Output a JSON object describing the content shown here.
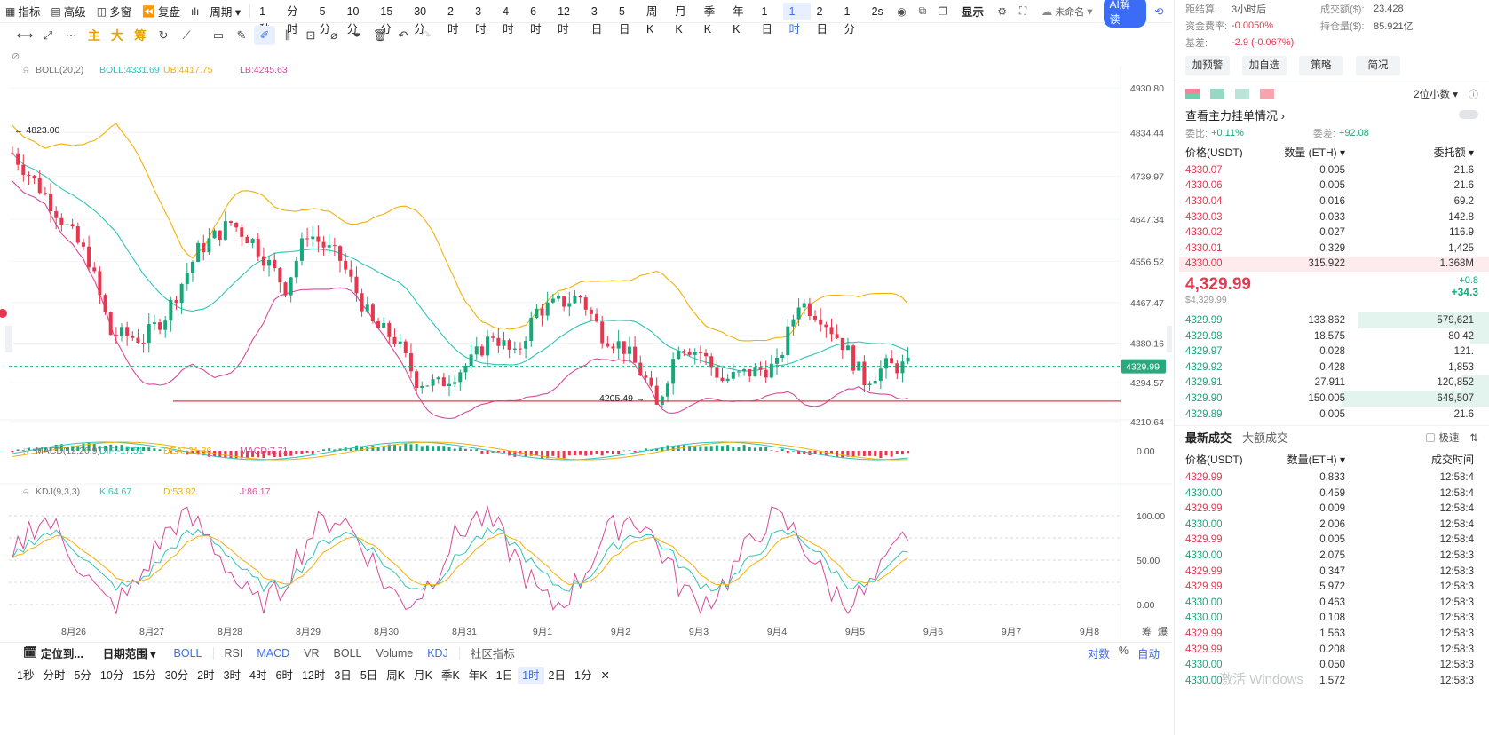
{
  "toolbar": {
    "items": [
      {
        "icon": "indicator-icon",
        "glyph": "▦",
        "label": "指标"
      },
      {
        "icon": "advanced-icon",
        "glyph": "▤",
        "label": "高级"
      },
      {
        "icon": "multi-window-icon",
        "glyph": "◫",
        "label": "多窗"
      },
      {
        "icon": "replay-icon",
        "glyph": "⏪",
        "label": "复盘"
      },
      {
        "icon": "candle-style-icon",
        "glyph": "ılı",
        "label": ""
      },
      {
        "icon": "period-icon",
        "glyph": "",
        "label": "周期 ▾"
      }
    ],
    "intervals": [
      "1秒",
      "分时",
      "5分",
      "10分",
      "15分",
      "30分",
      "2时",
      "3时",
      "4时",
      "6时",
      "12时",
      "3日",
      "5日",
      "周K",
      "月K",
      "季K",
      "年K",
      "1日",
      "1时",
      "2日",
      "1分"
    ],
    "active_interval": "1时",
    "right": {
      "speed": "2s",
      "display": "显示",
      "layout_name": "未命名",
      "ai_label": "AI解读"
    }
  },
  "drawtools": {
    "main_label": "主",
    "big_label": "大",
    "chip_label": "筹"
  },
  "chart": {
    "boll_legend": {
      "name": "BOLL(20,2)",
      "boll": "BOLL:4331.69",
      "ub": "UB:4417.75",
      "lb": "LB:4245.63"
    },
    "macd_legend": {
      "name": "MACD(12,26,9)",
      "dif": "DIF:-17.51",
      "dea": "DEA:-21.36",
      "macd": "MACD:7.71"
    },
    "kdj_legend": {
      "name": "KDJ(9,3,3)",
      "k": "K:64.67",
      "d": "D:53.92",
      "j": "J:86.17"
    },
    "price_axis": [
      "4930.80",
      "4834.44",
      "4739.97",
      "4647.34",
      "4556.52",
      "4467.47",
      "4380.16",
      "4294.57",
      "4210.64"
    ],
    "current_price": "4329.99",
    "high_label": "4823.00",
    "low_label": "4205.49",
    "support_level": 4255,
    "macd_axis": [
      "0.00"
    ],
    "kdj_axis": [
      "100.00",
      "50.00",
      "0.00"
    ],
    "dates": [
      "8月26",
      "8月27",
      "8月28",
      "8月29",
      "8月30",
      "8月31",
      "9月1",
      "9月2",
      "9月3",
      "9月4",
      "9月5",
      "9月6",
      "9月7",
      "9月8"
    ],
    "corner_labels": [
      "筹",
      "爆"
    ],
    "colors": {
      "up": "#19a67a",
      "down": "#e8364f",
      "mid": "#2ec4b6",
      "upper": "#f2b10a",
      "lower": "#d64a9a",
      "price_line": "#2aa97f",
      "support": "#e8364f"
    }
  },
  "indicator_bar": {
    "locate_label": "定位到...",
    "range_label": "日期范围 ▾",
    "tabs": [
      "BOLL",
      "RSI",
      "MACD",
      "VR",
      "BOLL",
      "Volume",
      "KDJ",
      "社区指标"
    ],
    "active_tabs": [
      "BOLL",
      "MACD",
      "KDJ"
    ],
    "right": [
      "对数",
      "%",
      "自动"
    ]
  },
  "bottom_intervals": [
    "1秒",
    "分时",
    "5分",
    "10分",
    "15分",
    "30分",
    "2时",
    "3时",
    "4时",
    "6时",
    "12时",
    "3日",
    "5日",
    "周K",
    "月K",
    "季K",
    "年K",
    "1日",
    "1时",
    "2日",
    "1分",
    "✕"
  ],
  "bottom_active": "1时",
  "panel": {
    "stats": [
      {
        "k1": "距结算:",
        "v1": "3小时后",
        "k2": "成交额($):",
        "v2": "23.428"
      },
      {
        "k1": "资金费率:",
        "v1": "-0.0050%",
        "k2": "持仓量($):",
        "v2": "85.921亿"
      },
      {
        "k1": "基差:",
        "v1": "-2.9 (-0.067%)",
        "k2": "",
        "v2": ""
      }
    ],
    "buttons": [
      "加预警",
      "加自选",
      "策略",
      "简况"
    ],
    "precision": "2位小数 ▾",
    "depth_title": "查看主力挂单情况 ›",
    "ratio": {
      "k1": "委比:",
      "v1": "+0.11%",
      "k2": "委差:",
      "v2": "+92.08"
    },
    "book_headers": [
      "价格(USDT)",
      "数量 (ETH) ▾",
      "委托额 ▾"
    ],
    "asks": [
      {
        "p": "4330.07",
        "q": "0.005",
        "t": "21.6"
      },
      {
        "p": "4330.06",
        "q": "0.005",
        "t": "21.6"
      },
      {
        "p": "4330.04",
        "q": "0.016",
        "t": "69.2"
      },
      {
        "p": "4330.03",
        "q": "0.033",
        "t": "142.8"
      },
      {
        "p": "4330.02",
        "q": "0.027",
        "t": "116.9"
      },
      {
        "p": "4330.01",
        "q": "0.329",
        "t": "1,425"
      },
      {
        "p": "4330.00",
        "q": "315.922",
        "t": "1.368M"
      }
    ],
    "mid": {
      "price": "4,329.99",
      "sub": "$4,329.99",
      "pct": "+0.8",
      "chg": "+34.3"
    },
    "bids": [
      {
        "p": "4329.99",
        "q": "133.862",
        "t": "579,621"
      },
      {
        "p": "4329.98",
        "q": "18.575",
        "t": "80.42"
      },
      {
        "p": "4329.97",
        "q": "0.028",
        "t": "121."
      },
      {
        "p": "4329.92",
        "q": "0.428",
        "t": "1,853"
      },
      {
        "p": "4329.91",
        "q": "27.911",
        "t": "120,852"
      },
      {
        "p": "4329.90",
        "q": "150.005",
        "t": "649,507"
      },
      {
        "p": "4329.89",
        "q": "0.005",
        "t": "21.6"
      }
    ],
    "trades_tabs": [
      "最新成交",
      "大额成交"
    ],
    "speed_label": "极速",
    "trade_headers": [
      "价格(USDT)",
      "数量(ETH) ▾",
      "成交时间"
    ],
    "trades": [
      {
        "p": "4329.99",
        "q": "0.833",
        "t": "12:58:4",
        "side": "down"
      },
      {
        "p": "4330.00",
        "q": "0.459",
        "t": "12:58:4",
        "side": "up"
      },
      {
        "p": "4329.99",
        "q": "0.009",
        "t": "12:58:4",
        "side": "down"
      },
      {
        "p": "4330.00",
        "q": "2.006",
        "t": "12:58:4",
        "side": "up"
      },
      {
        "p": "4329.99",
        "q": "0.005",
        "t": "12:58:4",
        "side": "down"
      },
      {
        "p": "4330.00",
        "q": "2.075",
        "t": "12:58:3",
        "side": "up"
      },
      {
        "p": "4329.99",
        "q": "0.347",
        "t": "12:58:3",
        "side": "down"
      },
      {
        "p": "4329.99",
        "q": "5.972",
        "t": "12:58:3",
        "side": "down"
      },
      {
        "p": "4330.00",
        "q": "0.463",
        "t": "12:58:3",
        "side": "up"
      },
      {
        "p": "4330.00",
        "q": "0.108",
        "t": "12:58:3",
        "side": "up"
      },
      {
        "p": "4329.99",
        "q": "1.563",
        "t": "12:58:3",
        "side": "down"
      },
      {
        "p": "4329.99",
        "q": "0.208",
        "t": "12:58:3",
        "side": "down"
      },
      {
        "p": "4330.00",
        "q": "0.050",
        "t": "12:58:3",
        "side": "up"
      },
      {
        "p": "4330.00",
        "q": "1.572",
        "t": "12:58:3",
        "side": "up"
      }
    ]
  },
  "watermark": "激活 Windows"
}
